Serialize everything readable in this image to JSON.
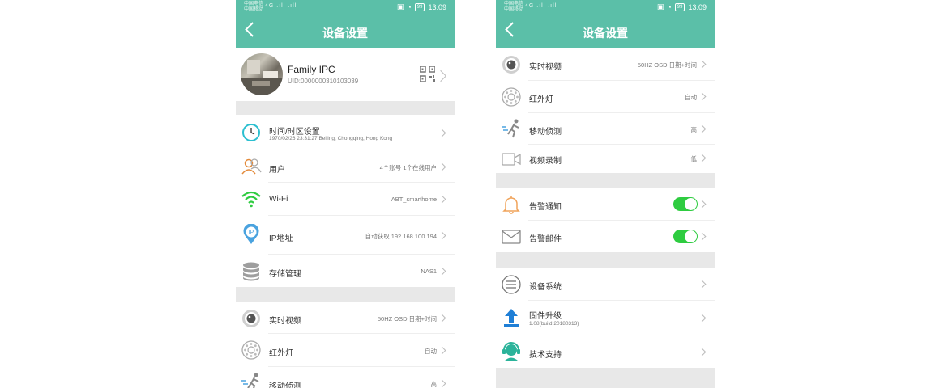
{
  "status_bar": {
    "carrier1": "中国电信",
    "carrier2": "中国移动",
    "signal": "4G .ıll .ıll",
    "battery": "99",
    "time": "13:09"
  },
  "nav": {
    "title": "设备设置"
  },
  "profile": {
    "name": "Family IPC",
    "uid": "UID:0000000310103039"
  },
  "left_items": {
    "time": {
      "label": "时间/时区设置",
      "sub": "1970/02/26 23:31:27  Beijing, Chongqing, Hong Kong"
    },
    "user": {
      "label": "用户",
      "value": "4个账号 1个在线用户"
    },
    "wifi": {
      "label": "Wi-Fi",
      "value": "ABT_smarthome"
    },
    "ip": {
      "label": "IP地址",
      "value": "自动获取  192.168.100.194",
      "icon_text": "IP"
    },
    "storage": {
      "label": "存储管理",
      "value": "NAS1"
    },
    "video": {
      "label": "实时视频",
      "value": "50HZ  OSD:日期+时间"
    },
    "ir": {
      "label": "红外灯",
      "value": "自动"
    },
    "motion": {
      "label": "移动侦测",
      "value": "高"
    }
  },
  "right_items": {
    "video": {
      "label": "实时视频",
      "value": "50HZ  OSD:日期+时间"
    },
    "ir": {
      "label": "红外灯",
      "value": "自动"
    },
    "motion": {
      "label": "移动侦测",
      "value": "高"
    },
    "record": {
      "label": "视频录制",
      "value": "低"
    },
    "alarm_notify": {
      "label": "告警通知",
      "enabled": true
    },
    "alarm_mail": {
      "label": "告警邮件",
      "enabled": true
    },
    "system": {
      "label": "设备系统"
    },
    "firmware": {
      "label": "固件升级",
      "sub": "1.08(build 20180313)"
    },
    "support": {
      "label": "技术支持"
    }
  },
  "colors": {
    "header": "#5bbfa8",
    "toggle_on": "#2ecc40",
    "wifi": "#2ecc40",
    "time_icon": "#2bbfd0",
    "ip_icon": "#4aa3df",
    "bell": "#f0a35a",
    "upload": "#1f7fd6",
    "support": "#2bb39a"
  }
}
